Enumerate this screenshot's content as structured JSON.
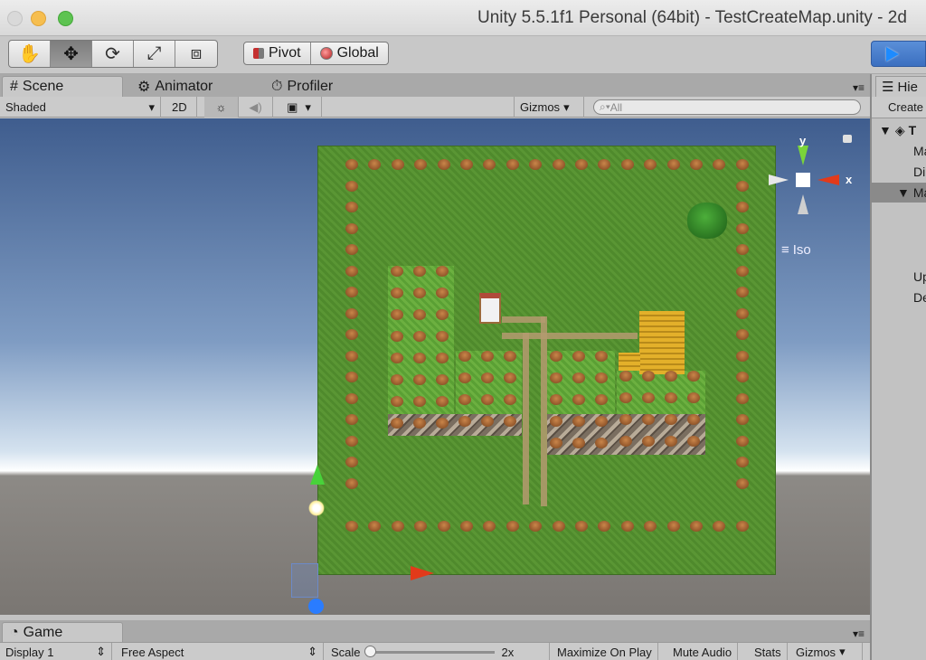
{
  "window": {
    "title": "Unity 5.5.1f1 Personal (64bit) - TestCreateMap.unity - 2d"
  },
  "toolbar": {
    "tools": [
      {
        "name": "hand-tool-icon",
        "glyph": "✋"
      },
      {
        "name": "move-tool-icon",
        "glyph": "✥"
      },
      {
        "name": "rotate-tool-icon",
        "glyph": "⟳"
      },
      {
        "name": "scale-tool-icon",
        "glyph": "⤢"
      },
      {
        "name": "rect-tool-icon",
        "glyph": "⧈"
      }
    ],
    "pivot_label": "Pivot",
    "global_label": "Global"
  },
  "scene_tabs": [
    {
      "label": "Scene",
      "icon": "#"
    },
    {
      "label": "Animator",
      "icon": "⚙"
    },
    {
      "label": "Profiler",
      "icon": "⏱"
    }
  ],
  "scene_bar": {
    "shading_mode": "Shaded",
    "two_d": "2D",
    "gizmos_label": "Gizmos",
    "search_placeholder": "All"
  },
  "scene_gizmo": {
    "y_label": "y",
    "x_label": "x",
    "projection_label": "Iso"
  },
  "game_tab": {
    "label": "Game",
    "display": "Display 1",
    "aspect": "Free Aspect",
    "scale_label": "Scale",
    "scale_value": "2x",
    "maximize_label": "Maximize On Play",
    "mute_label": "Mute Audio",
    "stats_label": "Stats",
    "gizmos_label": "Gizmos"
  },
  "hierarchy": {
    "tab_label": "Hie",
    "create_label": "Create",
    "items": [
      {
        "label": "T",
        "indent": 0,
        "expanded": true,
        "selected": false
      },
      {
        "label": "Ma",
        "indent": 1,
        "selected": false
      },
      {
        "label": "Di",
        "indent": 1,
        "selected": false
      },
      {
        "label": "Ma",
        "indent": 1,
        "expanded": true,
        "selected": true
      },
      {
        "label": "Up",
        "indent": 1,
        "selected": false
      },
      {
        "label": "De",
        "indent": 1,
        "selected": false
      }
    ]
  }
}
